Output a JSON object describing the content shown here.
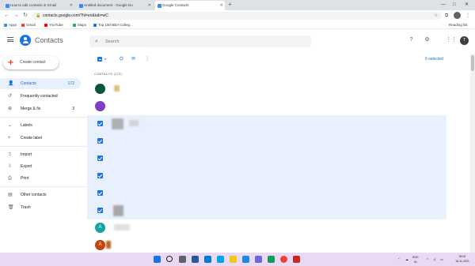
{
  "browser": {
    "tabs": [
      {
        "title": "How to edit contacts in Gmail",
        "active": false
      },
      {
        "title": "Untitled document - Google Do",
        "active": false
      },
      {
        "title": "Google Contacts",
        "active": true
      }
    ],
    "new_tab": "+",
    "window_controls": [
      "—",
      "□",
      "✕"
    ],
    "nav": {
      "back": "←",
      "forward": "→",
      "reload": "↻"
    },
    "url": "contacts.google.com/?hl=en&tab=wC",
    "bookmarks": [
      {
        "label": "Apps",
        "color": "#4285f4"
      },
      {
        "label": "Gmail",
        "color": "#ea4335"
      },
      {
        "label": "YouTube",
        "color": "#ff0000"
      },
      {
        "label": "Maps",
        "color": "#34a853"
      },
      {
        "label": "Top 150 BBA Colleg...",
        "color": "#1a73e8"
      }
    ],
    "reading_list": "Reading list"
  },
  "app": {
    "title": "Contacts",
    "search_placeholder": "Search",
    "avatar_initial": "T"
  },
  "sidebar": {
    "create_label": "Create contact",
    "items": [
      {
        "label": "Contacts",
        "count": "172",
        "icon": "person-icon",
        "glyph": "👤",
        "active": true
      },
      {
        "label": "Frequently contacted",
        "count": "",
        "icon": "history-icon",
        "glyph": "↺",
        "active": false
      },
      {
        "label": "Merge & fix",
        "count": "3",
        "icon": "merge-icon",
        "glyph": "⊕",
        "active": false
      }
    ],
    "labels_section": [
      {
        "label": "Labels",
        "icon": "chevron-icon",
        "glyph": "⌄"
      },
      {
        "label": "Create label",
        "icon": "plus-icon",
        "glyph": "+"
      }
    ],
    "tools": [
      {
        "label": "Import",
        "icon": "import-icon",
        "glyph": "⇪"
      },
      {
        "label": "Export",
        "icon": "export-icon",
        "glyph": "⇩"
      },
      {
        "label": "Print",
        "icon": "print-icon",
        "glyph": "⎙"
      }
    ],
    "other": [
      {
        "label": "Other contacts",
        "icon": "contacts-icon",
        "glyph": "▤"
      },
      {
        "label": "Trash",
        "icon": "trash-icon",
        "glyph": "🗑"
      }
    ]
  },
  "main": {
    "selected_label": "6 selected",
    "section_header": "CONTACTS (172)",
    "contacts": [
      {
        "kind": "avatar",
        "letter": "",
        "color": "#0b5345"
      },
      {
        "kind": "avatar",
        "letter": "",
        "color": "#7b3fbf"
      },
      {
        "kind": "checked"
      },
      {
        "kind": "checked"
      },
      {
        "kind": "checked"
      },
      {
        "kind": "checked"
      },
      {
        "kind": "checked"
      },
      {
        "kind": "checked"
      },
      {
        "kind": "avatar",
        "letter": "A",
        "color": "#12a4a6"
      },
      {
        "kind": "avatar",
        "letter": "A",
        "color": "#c1440e"
      }
    ]
  },
  "taskbar": {
    "apps": [
      "#1a73e8",
      "#202124",
      "#5f6368",
      "#2b579a",
      "#0078d4",
      "#00a4ef",
      "#1e88e5",
      "#0f9d58",
      "#ea4335",
      "#c62828"
    ],
    "weather": "☁",
    "language": "ENG\nIN",
    "time": "05:02",
    "date": "16-11-2021"
  },
  "colors": {
    "accent": "#1a73e8",
    "selected_row": "#e8f0fe",
    "taskbar": "#e9d9f2"
  }
}
